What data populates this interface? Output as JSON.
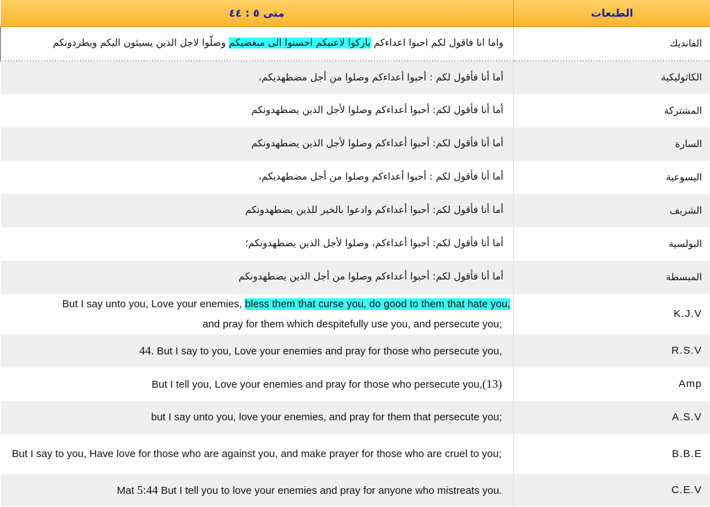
{
  "header": {
    "editions_label": "الطبعات",
    "reference": "متى ٥ : ٤٤"
  },
  "rows": [
    {
      "edition": "الفانديك",
      "pre": "واما انا فاقول لكم احبوا اعداءكم ",
      "hl": "باركوا لاعنيكم احسنوا الى مبغضيكم",
      "post": " وصلّوا لاجل الذين يسيئون اليكم ويطردونكم"
    },
    {
      "edition": "الكاثوليكية",
      "text": "أما أنا فأقول لكم : أحبوا أعداءكم وصلوا من أجل مضطهديكم،"
    },
    {
      "edition": "المشتركة",
      "text": "أما أنا فأقول لكم: أحبوا أعداءكم  وصلوا لأجل الذين يضطهدونكم"
    },
    {
      "edition": "السارة",
      "text": "أما أنا فأقول لكم: أحبوا أعداءكم  وصلوا لأجل الذين يضطهدونكم"
    },
    {
      "edition": "اليسوعية",
      "text": "أما أنا فأقول لكم : أحبوا أعداءكم وصلوا من أجل مضطهديكم،"
    },
    {
      "edition": "الشريف",
      "text": "أما أنا فأقول لكم: أحبوا أعداءكم  وادعوا بالخير للذين يضطهدونكم"
    },
    {
      "edition": "البولسية",
      "text": "أما أنا فأقول لكم: أحبوا أعداءكم، وصلوا لأجل الذين يضطهدونكم؛"
    },
    {
      "edition": "المبسطة",
      "text": "أما أنا فأقول لكم: أحبوا أعداءكم  وصلوا من أجل الذين يضطهدونكم"
    },
    {
      "edition": "K.J.V",
      "pre": "But I say unto you, Love your enemies, ",
      "hl": "bless them that curse you, do good to them that hate you,",
      "post": "and pray for them which despitefully use you, and persecute you;"
    },
    {
      "edition": "R.S.V",
      "num": "44.",
      "text": " But I say to you, Love your enemies and pray for those who persecute you,"
    },
    {
      "edition": "Amp",
      "text": "But I tell you, Love your enemies and pray for those who persecute you,",
      "num": "(13)"
    },
    {
      "edition": "A.S.V",
      "text": "but I say unto you, love your enemies, and pray for them that persecute you;"
    },
    {
      "edition": "B.B.E",
      "text": "But I say to you, Have love for those who are against you, and make prayer for those who are cruel to you;"
    },
    {
      "edition": "C.E.V",
      "pre": "Mat ",
      "num": "5:44",
      "text": "  But I tell you to love your enemies and pray for anyone who mistreats you."
    }
  ]
}
